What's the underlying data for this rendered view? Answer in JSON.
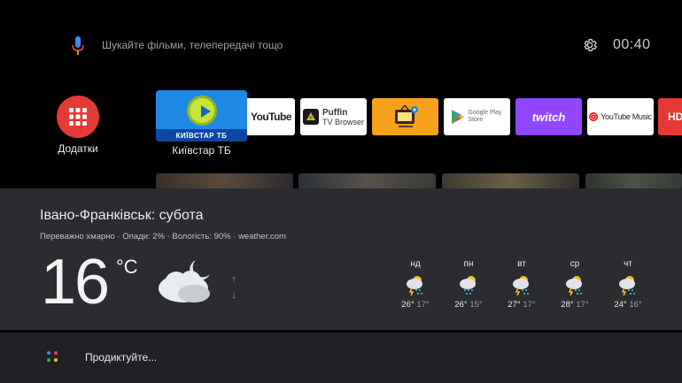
{
  "search": {
    "hint": "Шукайте фільми, телепередачі тощо"
  },
  "clock": {
    "time": "00:40"
  },
  "apps": {
    "label": "Додатки"
  },
  "focused_app": {
    "title": "Київстар ТБ",
    "logo_text": "КИЇВСТАР ТБ"
  },
  "tiles": {
    "youtube": "YouTube",
    "puffin_name": "Puffin",
    "puffin_sub": "TV Browser",
    "gplay_line1": "Google Play",
    "gplay_line2": "Store",
    "twitch": "twitch",
    "ytmusic": "YouTube Music",
    "hd": "HD"
  },
  "weather": {
    "title": "Івано-Франківськ: субота",
    "subtitle": "Переважно хмарно · Опади: 2% · Вологість: 90% · weather.com",
    "temp": "16",
    "unit": "°C",
    "arrow_up": "↑",
    "arrow_down": "↓",
    "forecast": [
      {
        "day": "нд",
        "hi": "26°",
        "lo": "17°"
      },
      {
        "day": "пн",
        "hi": "26°",
        "lo": "15°"
      },
      {
        "day": "вт",
        "hi": "27°",
        "lo": "17°"
      },
      {
        "day": "ср",
        "hi": "28°",
        "lo": "17°"
      },
      {
        "day": "чт",
        "hi": "24°",
        "lo": "16°"
      }
    ]
  },
  "assistant": {
    "prompt": "Продиктуйте..."
  },
  "colors": {
    "apps_red": "#e53935",
    "twitch_purple": "#9146ff",
    "weather_panel": "#2b2c2f",
    "assistant_bar": "#202124"
  }
}
